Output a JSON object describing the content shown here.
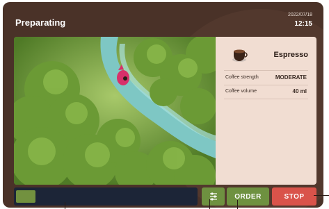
{
  "header": {
    "title": "Preparating",
    "date": "2022/07/18",
    "time": "12:15"
  },
  "product": {
    "name": "Espresso",
    "icon": "coffee-cup-icon",
    "settings": [
      {
        "label": "Coffee strength",
        "value": "MODERATE"
      },
      {
        "label": "Coffee volume",
        "value": "40 ml"
      }
    ]
  },
  "progress": {
    "value": 0.11
  },
  "buttons": {
    "settings_icon": "sliders-icon",
    "order_label": "ORDER",
    "stop_label": "STOP"
  },
  "colors": {
    "background": "#4a3228",
    "panel": "#f1ddd2",
    "accent_green": "#6e9140",
    "stop_red": "#d9534a",
    "progress_track": "#1c2537"
  }
}
